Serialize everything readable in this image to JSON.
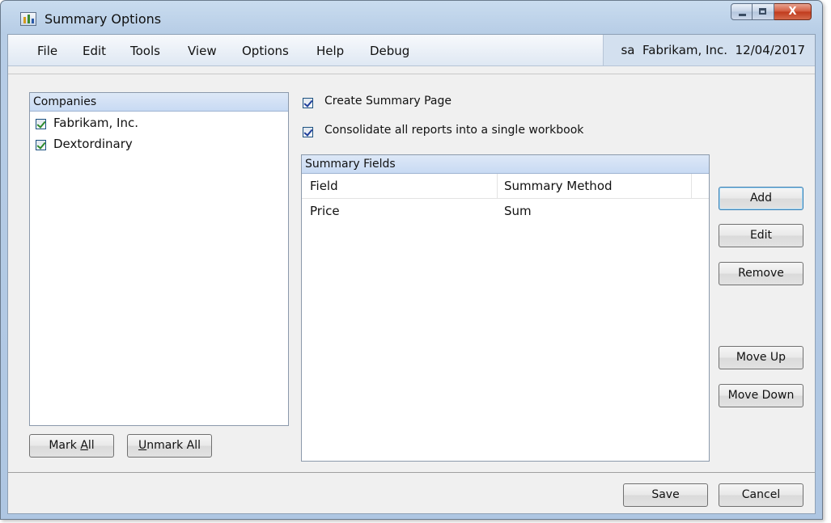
{
  "window": {
    "title": "Summary Options"
  },
  "menu": {
    "items": [
      "File",
      "Edit",
      "Tools",
      "View",
      "Options",
      "Help",
      "Debug"
    ],
    "company_info": "sa  Fabrikam, Inc.  12/04/2017"
  },
  "companies": {
    "header": "Companies",
    "items": [
      {
        "label": "Fabrikam, Inc.",
        "checked": true
      },
      {
        "label": "Dextordinary",
        "checked": true
      }
    ],
    "mark_all_prefix": "Mark ",
    "mark_all_mnemonic": "A",
    "mark_all_suffix": "ll",
    "unmark_all_prefix": "",
    "unmark_all_mnemonic": "U",
    "unmark_all_suffix": "nmark All"
  },
  "options": {
    "create_summary": {
      "label": "Create Summary Page",
      "checked": true
    },
    "consolidate": {
      "label": "Consolidate all reports into a single workbook",
      "checked": true
    }
  },
  "summary_fields": {
    "header": "Summary Fields",
    "columns": [
      "Field",
      "Summary Method"
    ],
    "rows": [
      {
        "field": "Price",
        "method": "Sum"
      }
    ]
  },
  "buttons": {
    "add": "Add",
    "edit": "Edit",
    "remove": "Remove",
    "move_up": "Move Up",
    "move_down": "Move Down",
    "save": "Save",
    "cancel": "Cancel"
  }
}
